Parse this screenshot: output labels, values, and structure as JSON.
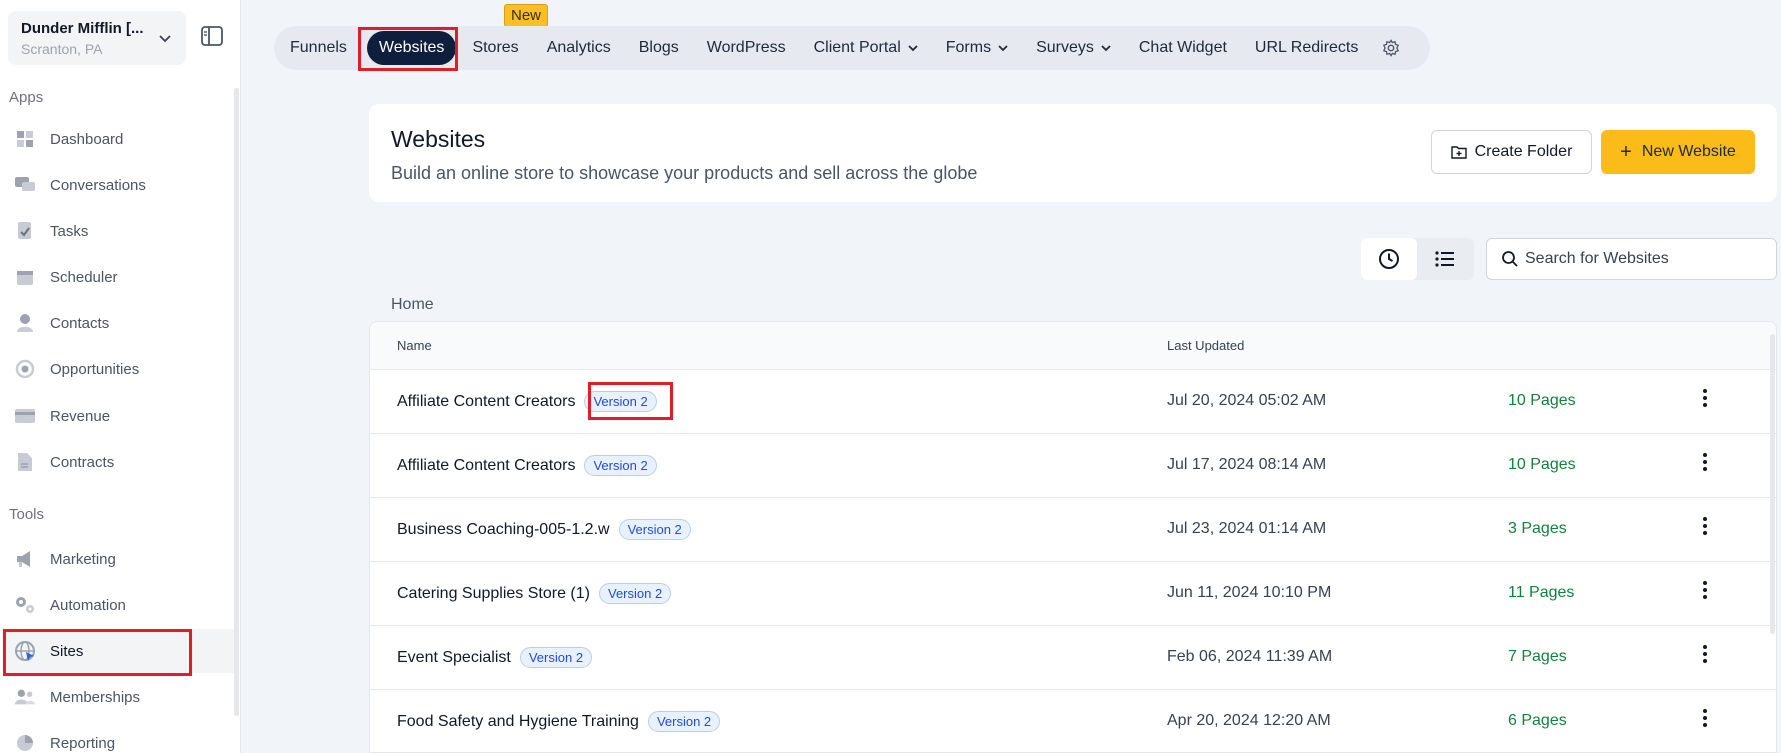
{
  "account": {
    "name": "Dunder Mifflin [...",
    "location": "Scranton, PA"
  },
  "sidebar": {
    "apps_title": "Apps",
    "tools_title": "Tools",
    "apps": [
      {
        "label": "Dashboard",
        "icon": "dashboard-icon"
      },
      {
        "label": "Conversations",
        "icon": "chat-icon"
      },
      {
        "label": "Tasks",
        "icon": "tasks-icon"
      },
      {
        "label": "Scheduler",
        "icon": "calendar-icon"
      },
      {
        "label": "Contacts",
        "icon": "person-icon"
      },
      {
        "label": "Opportunities",
        "icon": "target-icon"
      },
      {
        "label": "Revenue",
        "icon": "card-icon"
      },
      {
        "label": "Contracts",
        "icon": "document-icon"
      }
    ],
    "tools": [
      {
        "label": "Marketing",
        "icon": "megaphone-icon"
      },
      {
        "label": "Automation",
        "icon": "gears-icon"
      },
      {
        "label": "Sites",
        "icon": "globe-icon",
        "active": true
      },
      {
        "label": "Memberships",
        "icon": "users-icon"
      },
      {
        "label": "Reporting",
        "icon": "pie-icon"
      }
    ]
  },
  "topnav": {
    "new_badge": "New",
    "items": [
      {
        "label": "Funnels"
      },
      {
        "label": "Websites",
        "active": true
      },
      {
        "label": "Stores"
      },
      {
        "label": "Analytics"
      },
      {
        "label": "Blogs"
      },
      {
        "label": "WordPress"
      },
      {
        "label": "Client Portal",
        "dropdown": true
      },
      {
        "label": "Forms",
        "dropdown": true
      },
      {
        "label": "Surveys",
        "dropdown": true
      },
      {
        "label": "Chat Widget"
      },
      {
        "label": "URL Redirects"
      }
    ]
  },
  "header": {
    "title": "Websites",
    "subtitle": "Build an online store to showcase your products and sell across the globe",
    "create_folder": "Create Folder",
    "new_website": "New Website"
  },
  "search": {
    "placeholder": "Search for Websites"
  },
  "breadcrumb": "Home",
  "table": {
    "col_name": "Name",
    "col_updated": "Last Updated",
    "rows": [
      {
        "name": "Affiliate Content Creators",
        "badge": "Version 2",
        "updated": "Jul 20, 2024 05:02 AM",
        "pages": "10 Pages"
      },
      {
        "name": "Affiliate Content Creators",
        "badge": "Version 2",
        "updated": "Jul 17, 2024 08:14 AM",
        "pages": "10 Pages"
      },
      {
        "name": "Business Coaching-005-1.2.w",
        "badge": "Version 2",
        "updated": "Jul 23, 2024 01:14 AM",
        "pages": "3 Pages"
      },
      {
        "name": "Catering Supplies Store (1)",
        "badge": "Version 2",
        "updated": "Jun 11, 2024 10:10 PM",
        "pages": "11 Pages"
      },
      {
        "name": "Event Specialist",
        "badge": "Version 2",
        "updated": "Feb 06, 2024 11:39 AM",
        "pages": "7 Pages"
      },
      {
        "name": "Food Safety and Hygiene Training",
        "badge": "Version 2",
        "updated": "Apr 20, 2024 12:20 AM",
        "pages": "6 Pages"
      }
    ]
  },
  "colors": {
    "accent": "#fbbc1a",
    "active_nav": "#0f1e3c",
    "pages_green": "#15803d",
    "highlight": "#e11d2a"
  }
}
